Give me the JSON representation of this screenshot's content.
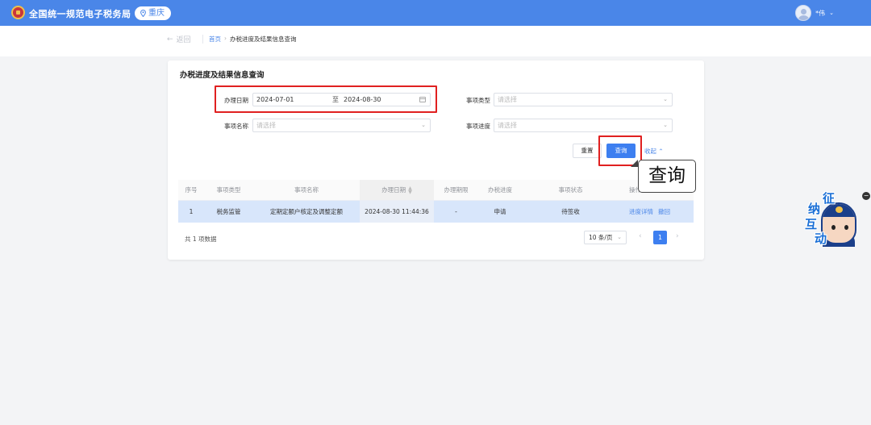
{
  "header": {
    "app_title": "全国统一规范电子税务局",
    "region": "重庆",
    "user_name": "*伟"
  },
  "breadcrumb": {
    "back_label": "返回",
    "home": "首页",
    "separator": "›",
    "current": "办税进度及结果信息查询"
  },
  "page": {
    "title": "办税进度及结果信息查询"
  },
  "form": {
    "date_label": "办理日期",
    "date_from": "2024-07-01",
    "date_to_sep": "至",
    "date_to": "2024-08-30",
    "item_type_label": "事项类型",
    "item_type_placeholder": "请选择",
    "item_name_label": "事项名称",
    "item_name_placeholder": "请选择",
    "item_progress_label": "事项进度",
    "item_progress_placeholder": "请选择",
    "reset_label": "重置",
    "query_label": "查询",
    "collapse_label": "收起"
  },
  "callout": {
    "text": "查询"
  },
  "table": {
    "columns": [
      "序号",
      "事项类型",
      "事项名称",
      "办理日期",
      "办理期限",
      "办税进度",
      "事项状态",
      "操作"
    ],
    "rows": [
      {
        "index": "1",
        "type": "税务监管",
        "name": "定期定额户核定及调整定额",
        "date": "2024-08-30 11:44:36",
        "deadline": "-",
        "progress": "申请",
        "status": "待签收",
        "action_detail": "进度详情",
        "action_withdraw": "撤回"
      }
    ]
  },
  "pagination": {
    "total_text": "共 1 项数据",
    "page_size": "10 条/页",
    "current_page": "1"
  },
  "widget": {
    "chars": [
      "征",
      "纳",
      "互",
      "动"
    ]
  },
  "colors": {
    "topbar": "#4a86e8",
    "primary": "#3d7ff0",
    "highlight_row": "#d8e6fb",
    "annotation_red": "#e02020"
  }
}
